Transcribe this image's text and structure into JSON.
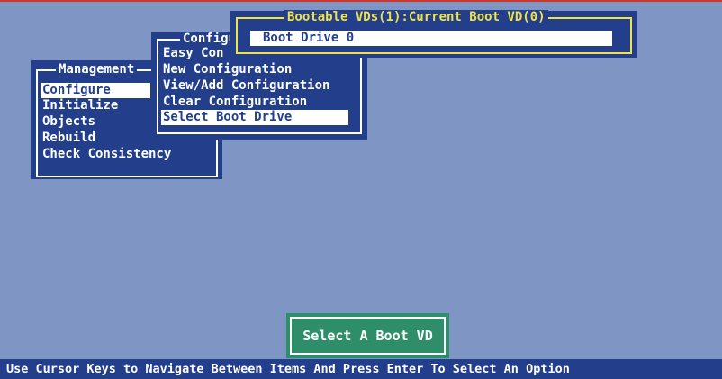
{
  "management_menu": {
    "title": "Management",
    "items": [
      {
        "label": "Configure",
        "selected": true
      },
      {
        "label": "Initialize",
        "selected": false
      },
      {
        "label": "Objects",
        "selected": false
      },
      {
        "label": "Rebuild",
        "selected": false
      },
      {
        "label": "Check Consistency",
        "selected": false
      }
    ]
  },
  "configure_menu": {
    "title": "Configu",
    "items": [
      {
        "label": "Easy Con",
        "selected": false
      },
      {
        "label": "New Configuration",
        "selected": false
      },
      {
        "label": "View/Add Configuration",
        "selected": false
      },
      {
        "label": "Clear Configuration",
        "selected": false
      },
      {
        "label": "Select Boot Drive",
        "selected": true
      }
    ]
  },
  "boot_vd_dialog": {
    "title": "Bootable VDs(1):Current Boot VD(0)",
    "items": [
      {
        "label": "Boot Drive 0",
        "selected": true
      }
    ]
  },
  "status_box": {
    "text": "Select A Boot VD"
  },
  "hint_bar": {
    "text": "Use Cursor Keys to Navigate Between Items And Press Enter To Select An Option"
  },
  "colors": {
    "background": "#7f96c4",
    "panel": "#233f8c",
    "highlight": "#ffffff",
    "dialog_border": "#f0e34a",
    "status_panel": "#2f8e6a"
  }
}
